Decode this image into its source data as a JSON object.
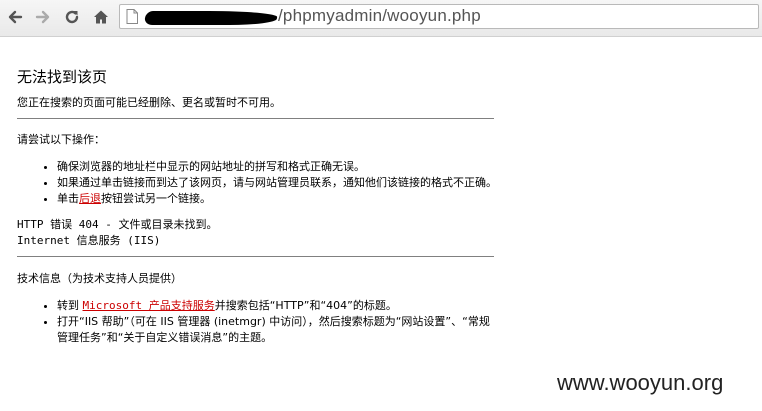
{
  "browser": {
    "url_visible": "/phpmyadmin/wooyun.php",
    "back_icon": "back-arrow-icon",
    "forward_icon": "forward-arrow-icon",
    "reload_icon": "reload-icon",
    "home_icon": "home-icon"
  },
  "page": {
    "title": "无法找到该页",
    "message": "您正在搜索的页面可能已经删除、更名或暂时不可用。",
    "try_heading": "请尝试以下操作：",
    "suggestions": [
      "确保浏览器的地址栏中显示的网站地址的拼写和格式正确无误。",
      "如果通过单击链接而到达了该网页，请与网站管理员联系，通知他们该链接的格式不正确。"
    ],
    "back_prefix": "单击",
    "back_link": "后退",
    "back_suffix": "按钮尝试另一个链接。",
    "error_line": "HTTP 错误 404 - 文件或目录未找到。",
    "server_line": "Internet 信息服务 (IIS)",
    "tech_heading": "技术信息（为技术支持人员提供）",
    "tech_item1_prefix": "转到 ",
    "tech_item1_link": "Microsoft 产品支持服务",
    "tech_item1_suffix": "并搜索包括“HTTP”和“404”的标题。",
    "tech_item2": "打开“IIS 帮助”（可在 IIS 管理器 (inetmgr) 中访问），然后搜索标题为“网站设置”、“常规管理任务”和“关于自定义错误消息”的主题。"
  },
  "watermark": "www.wooyun.org"
}
